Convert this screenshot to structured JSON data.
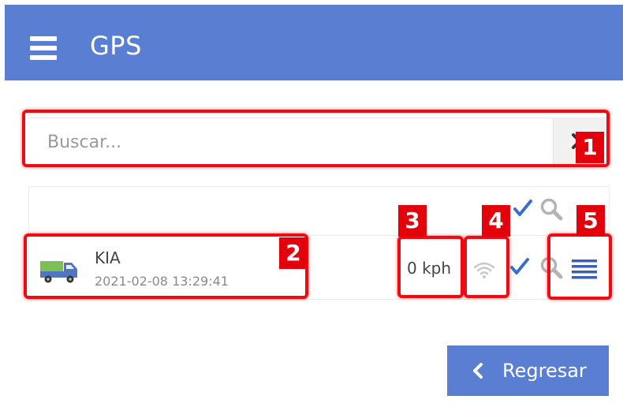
{
  "header": {
    "title": "GPS",
    "menu_icon": "hamburger-icon"
  },
  "search": {
    "placeholder": "Buscar...",
    "clear_icon": "close-icon"
  },
  "list_header": {
    "icons": [
      "checkmark-icon",
      "search-icon"
    ]
  },
  "vehicles": [
    {
      "name": "KIA",
      "timestamp": "2021-02-08 13:29:41",
      "speed": "0 kph",
      "icons": [
        "truck-icon",
        "wifi-icon",
        "checkmark-icon",
        "search-icon",
        "list-icon"
      ]
    }
  ],
  "callouts": [
    "1",
    "2",
    "3",
    "4",
    "5"
  ],
  "footer": {
    "back_label": "Regresar",
    "back_icon": "chevron-left-icon"
  },
  "colors": {
    "primary": "#5a7fd2",
    "annotation_red": "#f00a12",
    "check_blue": "#3a6fc9",
    "icon_gray": "#b3b3b3"
  }
}
